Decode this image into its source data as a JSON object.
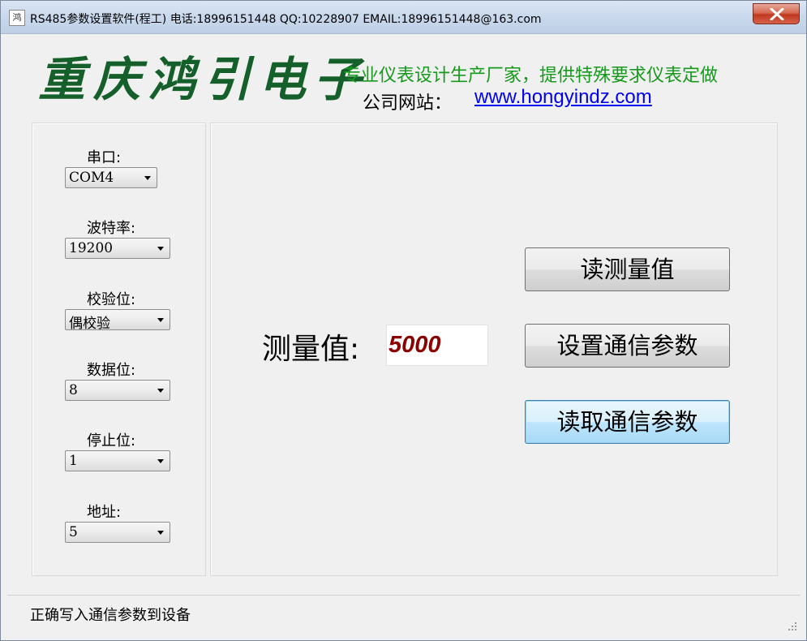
{
  "window": {
    "app_icon": "app-logo-icon",
    "title": "RS485参数设置软件(程工)  电话:18996151448  QQ:10228907  EMAIL:18996151448@163.com"
  },
  "header": {
    "brand": "重庆鸿引电子",
    "slogan": "专业仪表设计生产厂家，提供特殊要求仪表定做",
    "website_label": "公司网站：",
    "website_url": "www.hongyindz.com"
  },
  "settings": {
    "port": {
      "label": "串口:",
      "value": "COM4"
    },
    "baud": {
      "label": "波特率:",
      "value": "19200"
    },
    "parity": {
      "label": "校验位:",
      "value": "偶校验"
    },
    "databits": {
      "label": "数据位:",
      "value": "8"
    },
    "stopbits": {
      "label": "停止位:",
      "value": "1"
    },
    "address": {
      "label": "地址:",
      "value": "5"
    }
  },
  "main": {
    "measure_label": "测量值:",
    "measure_value": "5000",
    "read_measure_button": "读测量值",
    "set_comm_button": "设置通信参数",
    "read_comm_button": "读取通信参数"
  },
  "status": {
    "message": "正确写入通信参数到设备"
  },
  "colors": {
    "brand": "#15602a",
    "slogan": "#169a1c",
    "link": "#0000ee",
    "measure_value": "#8b0000"
  }
}
